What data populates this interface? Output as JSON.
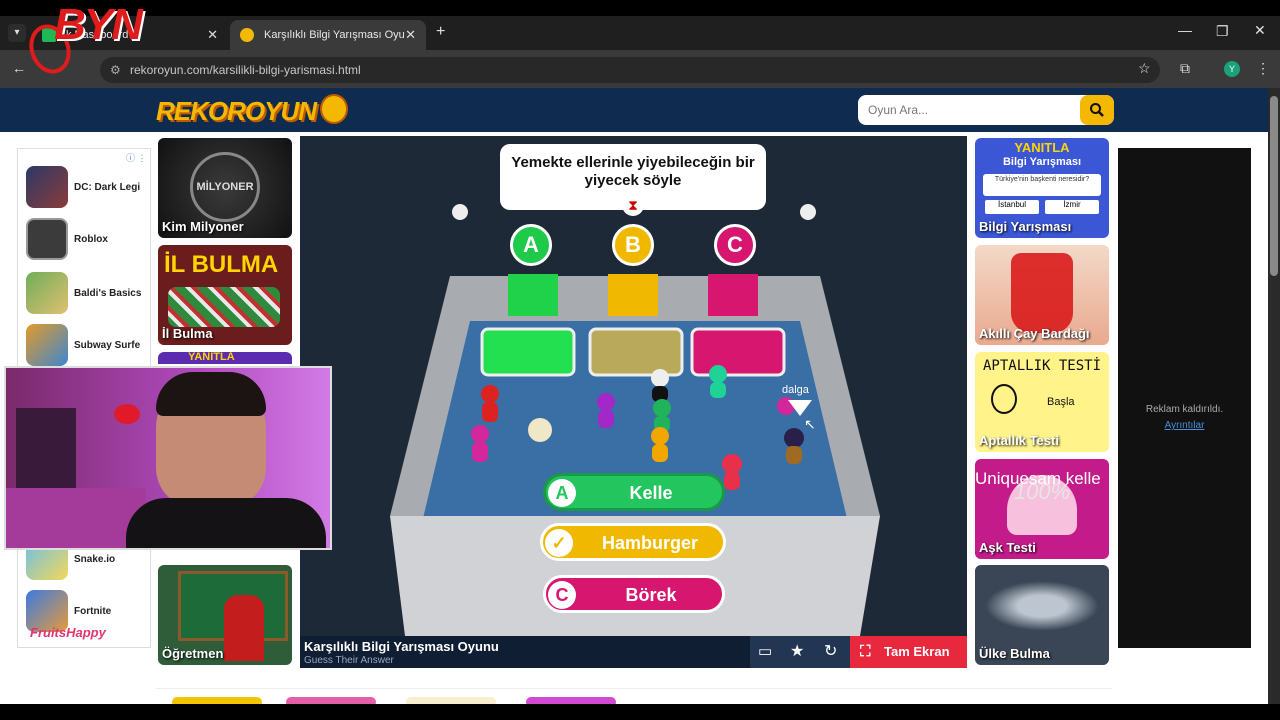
{
  "browser": {
    "tabs": [
      {
        "label": "k Dashboard"
      },
      {
        "label": "Karşılıklı Bilgi Yarışması Oyunu"
      }
    ],
    "url": "rekoroyun.com/karsilikli-bilgi-yarismasi.html",
    "profile_initial": "Y"
  },
  "site": {
    "logo": "REKOROYUN",
    "search_placeholder": "Oyun Ara..."
  },
  "left_ad": {
    "items": [
      {
        "name": "DC: Dark Legi"
      },
      {
        "name": "Roblox"
      },
      {
        "name": "Baldi's Basics"
      },
      {
        "name": "Subway Surfe"
      },
      {
        "name": "Snake.io"
      },
      {
        "name": "Fortnite"
      }
    ],
    "brand": "FruitsHappy"
  },
  "left_tiles": [
    {
      "label": "Kim Milyoner",
      "art": "MİLYONER"
    },
    {
      "label": "İl Bulma",
      "art": "İL BULMA"
    },
    {
      "label": "",
      "art": "YANITLA"
    },
    {
      "label": "Öğretmen",
      "art": ""
    }
  ],
  "right_tiles": [
    {
      "label": "Bilgi Yarışması",
      "art": "YANITLA",
      "art2": "Bilgi Yarışması",
      "art3": "Türkiye'nin başkenti neresidir?",
      "opt1": "İstanbul",
      "opt2": "İzmir"
    },
    {
      "label": "Akıllı Çay Bardağı"
    },
    {
      "label": "Aptallık Testi",
      "art": "APTALLIK TESTİ",
      "art2": "Başla"
    },
    {
      "label": "Aşk Testi",
      "art": "Uniquesam kelle",
      "art2": "100%"
    },
    {
      "label": "Ülke Bulma"
    }
  ],
  "right_ad": {
    "removed_text": "Reklam kaldırıldı.",
    "details_link": "Ayrıntılar"
  },
  "game": {
    "question": "Yemekte ellerinle yiyebileceğin bir yiyecek söyle",
    "letters": [
      "A",
      "B",
      "C"
    ],
    "player_tag": "dalga",
    "answers": [
      {
        "letter": "A",
        "text": "Kelle",
        "color": "#22c55e"
      },
      {
        "letter": "✓",
        "text": "Hamburger",
        "color": "#f0b800"
      },
      {
        "letter": "C",
        "text": "Börek",
        "color": "#d6166f"
      }
    ],
    "title": "Karşılıklı Bilgi Yarışması Oyunu",
    "subtitle": "Guess Their Answer",
    "fullscreen_label": "Tam Ekran"
  },
  "overlay": {
    "watermark": "BYN"
  }
}
